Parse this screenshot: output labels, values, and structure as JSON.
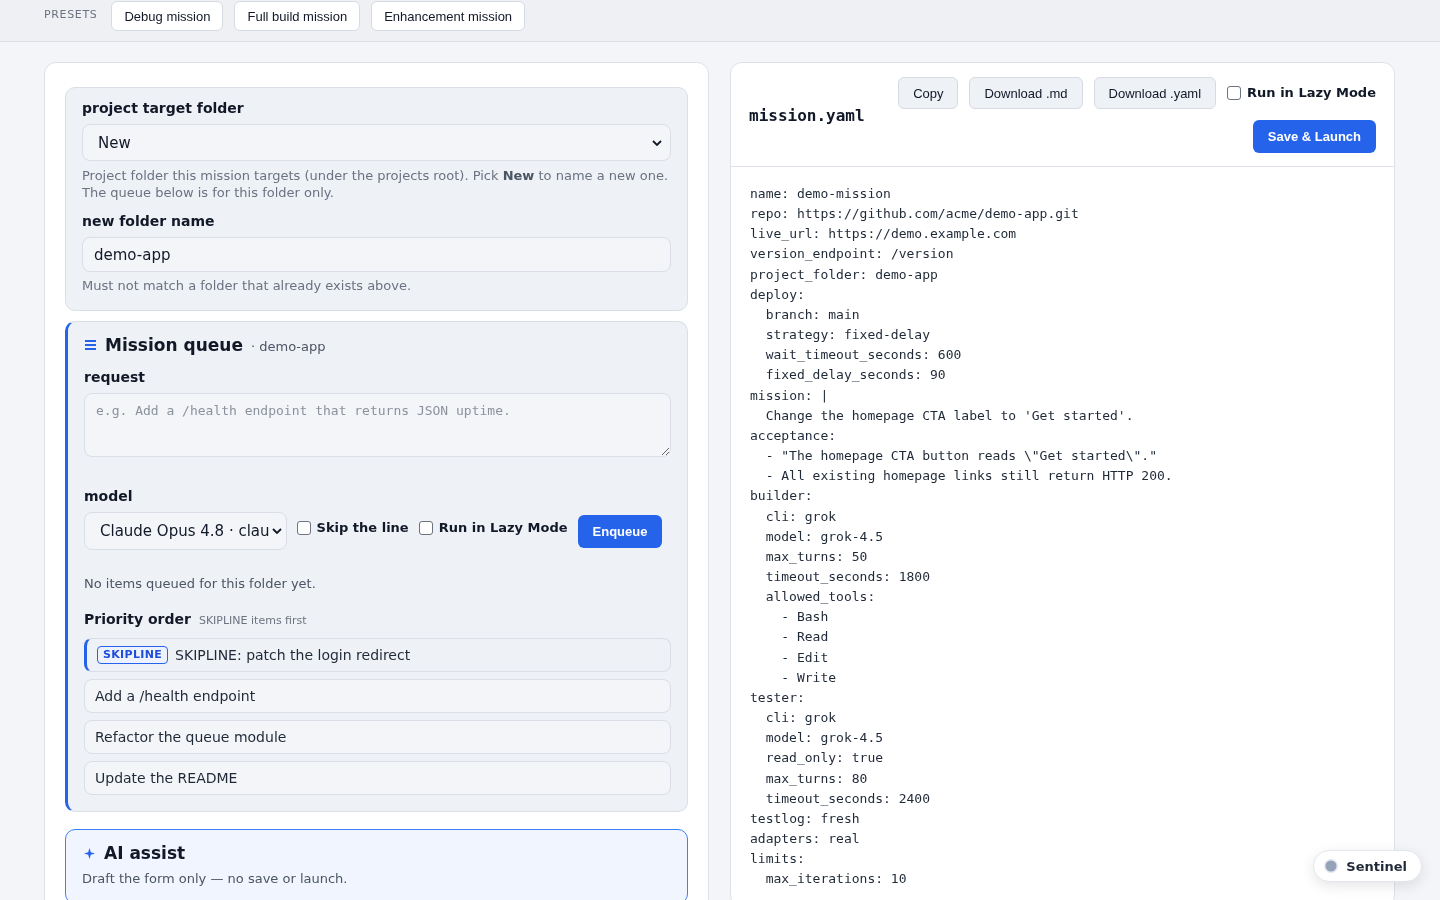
{
  "presets": {
    "label": "PRESETS",
    "buttons": [
      "Debug mission",
      "Full build mission",
      "Enhancement mission"
    ]
  },
  "form": {
    "target_folder": {
      "label": "project target folder",
      "value": "New",
      "help": "Project folder this mission targets (under the projects root). Pick **New** to name a new one. The queue below is for this folder only."
    },
    "new_folder": {
      "label": "new folder name",
      "value": "demo-app",
      "help": "Must not match a folder that already exists above."
    },
    "queue": {
      "title": "Mission queue",
      "folder": "· demo-app",
      "request": {
        "label": "request",
        "placeholder": "e.g. Add a /health endpoint that returns JSON uptime."
      },
      "model": {
        "label": "model",
        "value": "Claude Opus 4.8 · clau"
      },
      "options": [
        {
          "label": "Skip the line",
          "checked": false
        },
        {
          "label": "Run in Lazy Mode",
          "checked": false
        }
      ],
      "enqueue": "Enqueue",
      "empty_note": "No items queued for this folder yet.",
      "priority": {
        "title": "Priority order",
        "note": "SKIPLINE items first"
      },
      "items": [
        {
          "kind": "skipline",
          "badge": "SKIPLINE",
          "text": "SKIPLINE: patch the login redirect"
        },
        {
          "kind": "normal",
          "text": "Add a /health endpoint"
        },
        {
          "kind": "normal",
          "text": "Refactor the queue module"
        },
        {
          "kind": "normal",
          "text": "Update the README"
        }
      ]
    },
    "ai_assist": {
      "title": "AI assist",
      "subtitle": "Draft the form only — no save or launch."
    }
  },
  "preview": {
    "filename": "mission.yaml",
    "buttons": [
      "Copy",
      "Download .md",
      "Download .yaml"
    ],
    "lazy_mode": {
      "label": "Run in Lazy Mode",
      "checked": false
    },
    "launch": "Save & Launch",
    "lines": [
      {
        "text": "name: demo-mission"
      },
      {
        "text": "repo: https://github.com/acme/demo-app.git"
      },
      {
        "text": "live_url: https://demo.example.com"
      },
      {
        "text": "version_endpoint: /version"
      },
      {
        "text": "project_folder: demo-app"
      },
      {
        "text": "deploy:",
        "children": [
          {
            "text": "branch: main"
          },
          {
            "text": "strategy: fixed-delay"
          },
          {
            "text": "wait_timeout_seconds: 600"
          },
          {
            "text": "fixed_delay_seconds: 90"
          }
        ]
      },
      {
        "text": "mission: |",
        "children": [
          {
            "text": "Change the homepage CTA label to 'Get started'."
          }
        ]
      },
      {
        "text": "acceptance:",
        "children": [
          {
            "text": "- \"The homepage CTA button reads \\\"Get started\\\".\""
          },
          {
            "text": "- All existing homepage links still return HTTP 200."
          }
        ]
      },
      {
        "text": "builder:",
        "children": [
          {
            "text": "cli: grok"
          },
          {
            "text": "model: grok-4.5"
          },
          {
            "text": "max_turns: 50"
          },
          {
            "text": "timeout_seconds: 1800"
          },
          {
            "text": "allowed_tools:",
            "children": [
              {
                "text": "- Bash"
              },
              {
                "text": "- Read"
              },
              {
                "text": "- Edit"
              },
              {
                "text": "- Write"
              }
            ]
          }
        ]
      },
      {
        "text": "tester:",
        "children": [
          {
            "text": "cli: grok"
          },
          {
            "text": "model: grok-4.5"
          },
          {
            "text": "read_only: true"
          },
          {
            "text": "max_turns: 80"
          },
          {
            "text": "timeout_seconds: 2400"
          }
        ]
      },
      {
        "text": "testlog: fresh"
      },
      {
        "text": "adapters: real"
      },
      {
        "text": "limits:",
        "children": [
          {
            "text": "max_iterations: 10"
          }
        ]
      }
    ]
  },
  "sentinel": {
    "label": "Sentinel"
  }
}
